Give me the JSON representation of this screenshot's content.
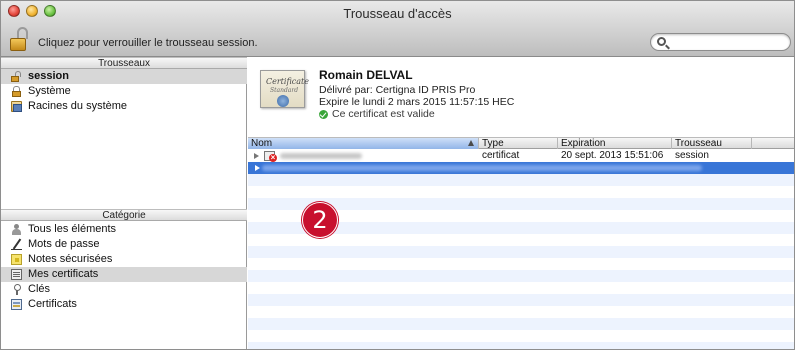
{
  "window": {
    "title": "Trousseau d'accès"
  },
  "toolbar": {
    "lock_text": "Cliquez pour verrouiller le trousseau session.",
    "search_placeholder": ""
  },
  "sidebar": {
    "keychains_header": "Trousseaux",
    "keychains": [
      {
        "label": "session",
        "icon": "lock-open-icon",
        "selected": true
      },
      {
        "label": "Système",
        "icon": "lock-icon",
        "selected": false
      },
      {
        "label": "Racines du système",
        "icon": "folder-icon",
        "selected": false
      }
    ],
    "category_header": "Catégorie",
    "categories": [
      {
        "label": "Tous les éléments",
        "icon": "person-icon",
        "selected": false
      },
      {
        "label": "Mots de passe",
        "icon": "pen-icon",
        "selected": false
      },
      {
        "label": "Notes sécurisées",
        "icon": "note-icon",
        "selected": false
      },
      {
        "label": "Mes certificats",
        "icon": "certificate-icon",
        "selected": true
      },
      {
        "label": "Clés",
        "icon": "key-icon",
        "selected": false
      },
      {
        "label": "Certificats",
        "icon": "certificate-stack-icon",
        "selected": false
      }
    ]
  },
  "detail": {
    "image_line1": "Certificate",
    "image_line2": "Standard",
    "name": "Romain DELVAL",
    "issuer": "Délivré par: Certigna ID PRIS Pro",
    "expires": "Expire le lundi 2 mars 2015 11:57:15 HEC",
    "status": "Ce certificat est valide"
  },
  "table": {
    "columns": [
      "Nom",
      "Type",
      "Expiration",
      "Trousseau"
    ],
    "rows": [
      {
        "name": "",
        "type": "certificat",
        "expiration": "20 sept. 2013 15:51:06",
        "keychain": "session"
      }
    ]
  },
  "callout": {
    "number": "2"
  },
  "colors": {
    "selection": "#3875d7",
    "alt_row": "#edf3fe",
    "badge": "#c8102e"
  }
}
